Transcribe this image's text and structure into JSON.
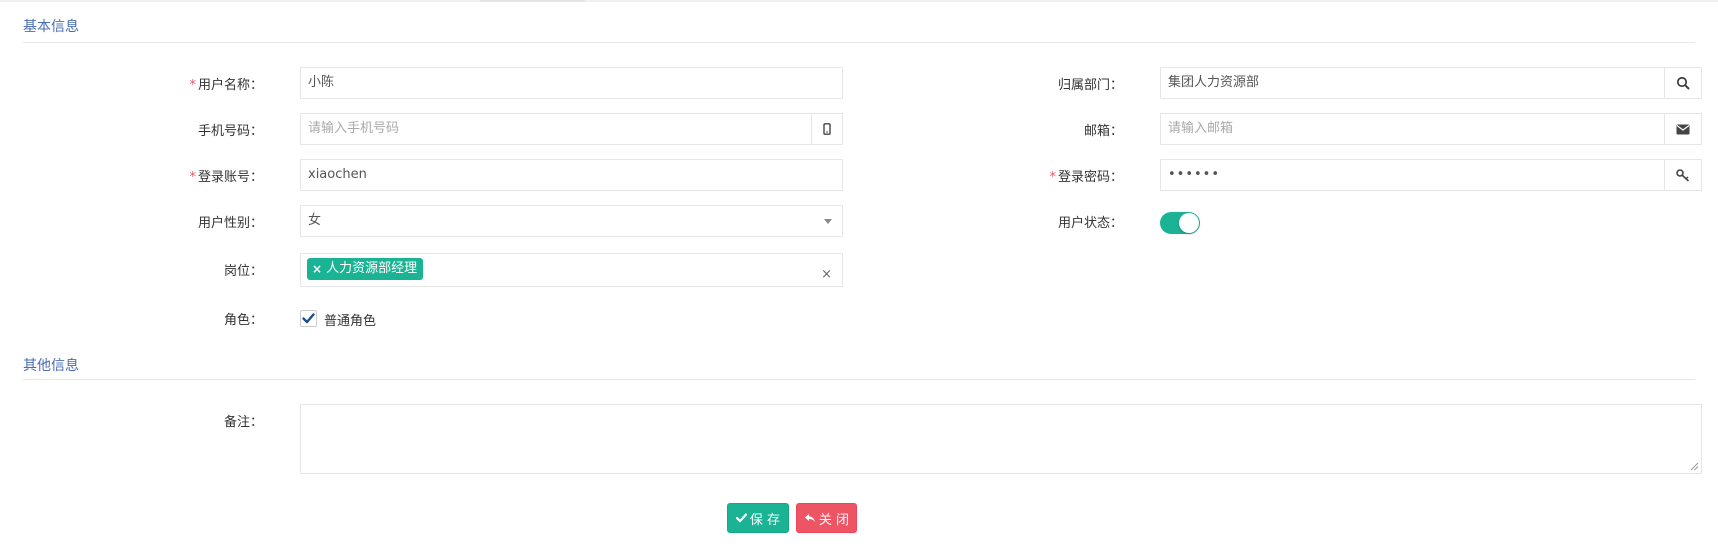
{
  "sections": {
    "basic": "基本信息",
    "other": "其他信息"
  },
  "form": {
    "user_name": {
      "label": "用户名称：",
      "value": "小陈",
      "required": true
    },
    "dept": {
      "label": "归属部门：",
      "value": "集团人力资源部",
      "icon": "search-icon"
    },
    "phone": {
      "label": "手机号码：",
      "placeholder": "请输入手机号码",
      "icon": "mobile-icon"
    },
    "email": {
      "label": "邮箱：",
      "placeholder": "请输入邮箱",
      "icon": "envelope-icon"
    },
    "login_name": {
      "label": "登录账号：",
      "value": "xiaochen",
      "required": true
    },
    "password": {
      "label": "登录密码：",
      "value": "••••••",
      "required": true,
      "icon": "key-icon"
    },
    "sex": {
      "label": "用户性别：",
      "value": "女"
    },
    "status": {
      "label": "用户状态：",
      "enabled": true
    },
    "post": {
      "label": "岗位：",
      "tags": [
        "人力资源部经理"
      ],
      "clear": "×",
      "tag_remove": "×"
    },
    "role": {
      "label": "角色：",
      "options": [
        {
          "label": "普通角色",
          "checked": true
        }
      ]
    },
    "remark": {
      "label": "备注：",
      "value": ""
    }
  },
  "buttons": {
    "save": "保 存",
    "close": "关 闭"
  },
  "colors": {
    "primary": "#1ab394",
    "danger": "#ed5565",
    "section_title": "#4a6cb3",
    "required": "#ed5565"
  }
}
